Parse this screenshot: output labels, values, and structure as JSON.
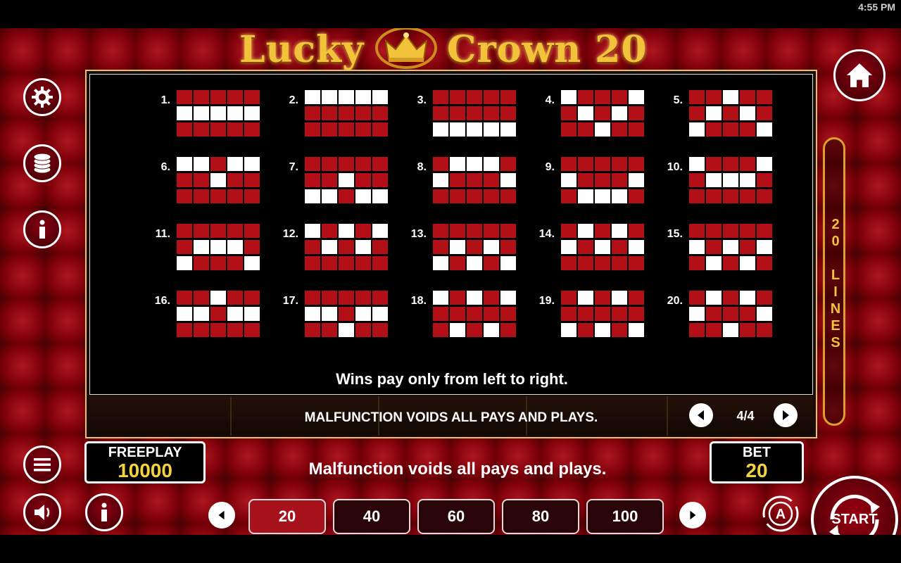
{
  "status_bar": {
    "time": "4:55 PM"
  },
  "game": {
    "title_part1": "Lucky",
    "title_part2": "Crown 20"
  },
  "paylines": {
    "lines": [
      {
        "label": "1.",
        "rows": [
          "00000",
          "11111",
          "00000"
        ]
      },
      {
        "label": "2.",
        "rows": [
          "11111",
          "00000",
          "00000"
        ]
      },
      {
        "label": "3.",
        "rows": [
          "00000",
          "00000",
          "11111"
        ]
      },
      {
        "label": "4.",
        "rows": [
          "10001",
          "01010",
          "00100"
        ]
      },
      {
        "label": "5.",
        "rows": [
          "00100",
          "01010",
          "10001"
        ]
      },
      {
        "label": "6.",
        "rows": [
          "11011",
          "00100",
          "00000"
        ]
      },
      {
        "label": "7.",
        "rows": [
          "00000",
          "00100",
          "11011"
        ]
      },
      {
        "label": "8.",
        "rows": [
          "01110",
          "10001",
          "00000"
        ]
      },
      {
        "label": "9.",
        "rows": [
          "00000",
          "10001",
          "01110"
        ]
      },
      {
        "label": "10.",
        "rows": [
          "10001",
          "01110",
          "00000"
        ]
      },
      {
        "label": "11.",
        "rows": [
          "00000",
          "01110",
          "10001"
        ]
      },
      {
        "label": "12.",
        "rows": [
          "10101",
          "01010",
          "00000"
        ]
      },
      {
        "label": "13.",
        "rows": [
          "00000",
          "01010",
          "10101"
        ]
      },
      {
        "label": "14.",
        "rows": [
          "01010",
          "10101",
          "00000"
        ]
      },
      {
        "label": "15.",
        "rows": [
          "00000",
          "10101",
          "01010"
        ]
      },
      {
        "label": "16.",
        "rows": [
          "00100",
          "11011",
          "00000"
        ]
      },
      {
        "label": "17.",
        "rows": [
          "00000",
          "11011",
          "00100"
        ]
      },
      {
        "label": "18.",
        "rows": [
          "10101",
          "00000",
          "01010"
        ]
      },
      {
        "label": "19.",
        "rows": [
          "01010",
          "00000",
          "10101"
        ]
      },
      {
        "label": "20.",
        "rows": [
          "01010",
          "10001",
          "00100"
        ]
      }
    ],
    "wins_note": "Wins pay only from left to right.",
    "malfunction_upper": "MALFUNCTION VOIDS ALL PAYS AND PLAYS.",
    "page_indicator": "4/4",
    "lines_tag": "20 LINES"
  },
  "freeplay": {
    "label": "FREEPLAY",
    "value": "10000"
  },
  "bet": {
    "label": "BET",
    "value": "20"
  },
  "status_message": "Malfunction voids all pays and plays.",
  "bet_options": [
    "20",
    "40",
    "60",
    "80",
    "100"
  ],
  "selected_bet": "20",
  "start_label": "START",
  "colors": {
    "cell_on": "#ffffff",
    "cell_off": "#b30f17",
    "gold": "#f2c23a",
    "background": "#6e0008"
  }
}
